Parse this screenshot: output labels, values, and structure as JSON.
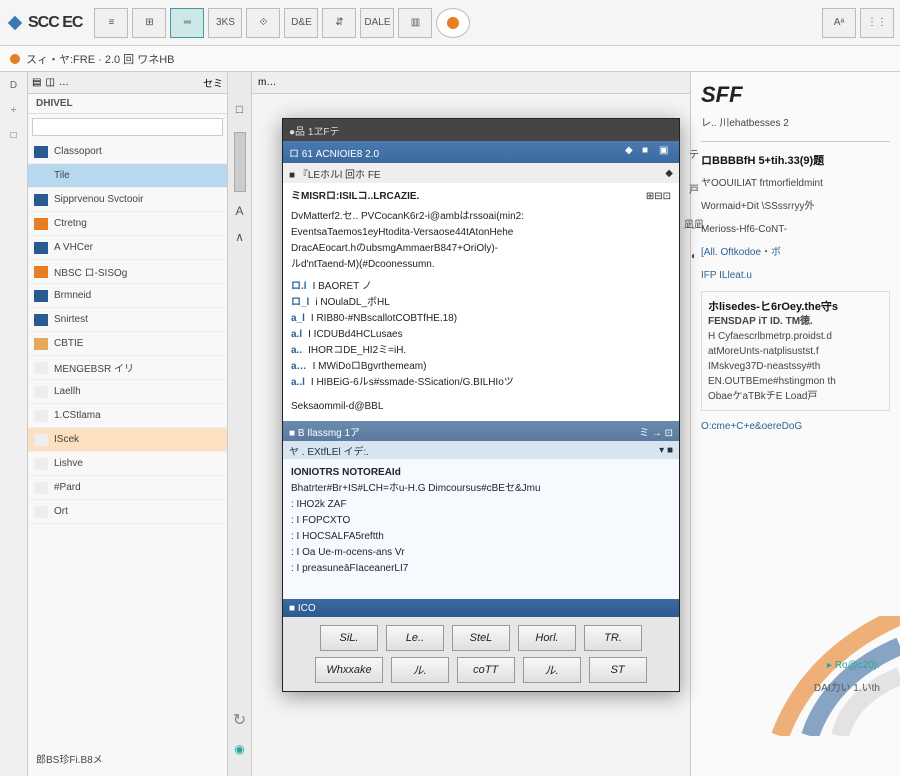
{
  "app": {
    "name": "SCC EC",
    "brand_right": "SFF"
  },
  "topbar": {
    "buttons": [
      "≡",
      "⊞",
      "═",
      "3KS",
      "⟐",
      "D&E",
      "⇵",
      "DALE",
      "▥",
      "◉"
    ],
    "right": [
      "Aᵃ",
      "⋮⋮"
    ]
  },
  "breadcrumb": "スィ・ヤ:FRE · 2.0 回 ワネHB",
  "rail": [
    "D",
    "÷",
    "□"
  ],
  "left_panel": {
    "toolbar": [
      "▤",
      "◫",
      "…",
      "⇲"
    ],
    "tabs_right": "セミ",
    "header": "DHIVEL",
    "items": [
      {
        "color": "#2a5a90",
        "label": "Classoport",
        "selected": false
      },
      {
        "color": "#b8d8f0",
        "label": "Tile",
        "selected": true
      },
      {
        "color": "#2a5a90",
        "label": "Sipprvenou  Svctooir"
      },
      {
        "color": "#e67e22",
        "label": "Ctretng"
      },
      {
        "color": "#2a5a90",
        "label": "A VHCer"
      },
      {
        "color": "#e67e22",
        "label": "NBSC  ロ-SISOg"
      },
      {
        "color": "#2a5a90",
        "label": "Brmneid"
      },
      {
        "color": "#2a5a90",
        "label": "Snirtest"
      },
      {
        "color": "#e6a85c",
        "label": "CBTIE"
      },
      {
        "color": "#eee",
        "label": "MENGEBSR  イリ"
      },
      {
        "color": "#eee",
        "label": "Laellh"
      },
      {
        "color": "#eee",
        "label": "1.CStlama"
      },
      {
        "color": "#eee",
        "label": "IScek"
      },
      {
        "color": "#eee",
        "label": "Lishve"
      },
      {
        "color": "#eee",
        "label": "#Pard"
      },
      {
        "color": "#eee",
        "label": "Ort"
      }
    ],
    "highlight_index": 12
  },
  "center": {
    "tab_label": "m…"
  },
  "gutter": [
    "□",
    "A",
    "∧"
  ],
  "modal": {
    "title": "●品 1ヱFテ",
    "header": "ロ 61 ACNIOIE8 2.0",
    "header_icons": [
      "◆",
      "■",
      "▣"
    ],
    "subtoolbar": "■ 『LEホルl 回ホ  FE",
    "path": "ミMISRロ:ISILコ..LRCAZIE.",
    "body_icons": [
      "⊞",
      "⊟",
      "⊡"
    ],
    "paragraphs": [
      "DvMatterf2.セ..  PVCocanK6r2-i@ambはrssoai(min2:",
      "EventsaTaemos1eyHtodita-Versaose44tAtonHehe",
      "DracAEocart.hのubsmgAmmaerB847+OriOly)-",
      "ルd'ntTaend-M)(#Dcoonessumn."
    ],
    "numbered": [
      {
        "idx": "ロ.l",
        "text": "I BAORET ノ"
      },
      {
        "idx": "ロ_l",
        "text": "i NOulaDL_ボHL"
      },
      {
        "idx": "a_l",
        "text": "I RIB80-#NBscallotCOBTfHE.18)"
      },
      {
        "idx": "a.l",
        "text": "I ICDUBd4HCLusaes"
      },
      {
        "idx": "a..",
        "text": "IHORコDE_HI2ミ=iH."
      },
      {
        "idx": "a…",
        "text": "I MWiDoロBgvrthemeam)"
      },
      {
        "idx": "a..l",
        "text": "I HIBEiG-6ルs#ssmade-SSication/G.BILHIoツ"
      }
    ],
    "body_footer": "Seksaommil-d@BBL",
    "filter_label": "■ B Ilassmg 1ア",
    "filter_right": "ミ → ⊡",
    "lower_toolbar": "ヤ . EXtfLEl イデ:.",
    "lower_toolbar_right": "▾ ■",
    "lower_header": "IONIOTRS NOTOREAId",
    "lower_long": "Bhatrter#Br+IS#LCH=ホu-H.G Dimcoursus#cBEセ&Jmu",
    "lower_items": [
      ": IHO2k ZAF",
      ": I FOPCXTO",
      ": I HOCSALFA5reftth",
      ": I Oa Ue-m-ocens-ans Vr",
      ": I preasuneāFIaceanerLI7"
    ],
    "status": "■  ICO",
    "button_row1": [
      "SiL.",
      "Le..",
      "SteL",
      "Horl.",
      "TR."
    ],
    "button_row2": [
      "Whxxake",
      "ル.",
      "coTT",
      "ル.",
      "ST"
    ]
  },
  "modal_side": [
    {
      "icon": "テ",
      "label": ""
    },
    {
      "icon": "戸",
      "label": ""
    },
    {
      "icon": "凪凪",
      "label": ""
    },
    {
      "icon": "◐",
      "label": ""
    }
  ],
  "right_panel": {
    "sublabel": "レ.. 川ehatbesses 2",
    "heading1": "ロBBBBfH 5+tih.33(9)题",
    "lines1": [
      "ヤOOUILIAT frtmorfieldmint",
      "Wormaid+Dit \\SSssrryy外",
      "Merioss-Hf6-CoNT-"
    ],
    "link1": "[All. Oftkodoe・ボ",
    "link2": "IFP  ILleat.u",
    "card_title": "ホlisedes-ヒ6rOey.the守s",
    "card_sub": "FENSDAP iT ID.  TM徳.",
    "card_lines": [
      "H Cyfaescrlbmetrp.proidst.d",
      "atMoreUnts-natplisustst.f",
      "IMskveg37D-neastssy#th",
      "EN.OUTBEme#hstingmon th",
      "ObaeケaTBkチE Load戸"
    ],
    "footer_link": "O:cme+C+e&oereDoG",
    "badge1": "Ro@c20).",
    "badge2": "DAI力い 1.いth"
  },
  "bottom_left": "郎BS珍Fi.B8メ",
  "colors": {
    "blue": "#3a6aa0",
    "orange": "#e67e22",
    "dark": "#3a3a3a"
  }
}
